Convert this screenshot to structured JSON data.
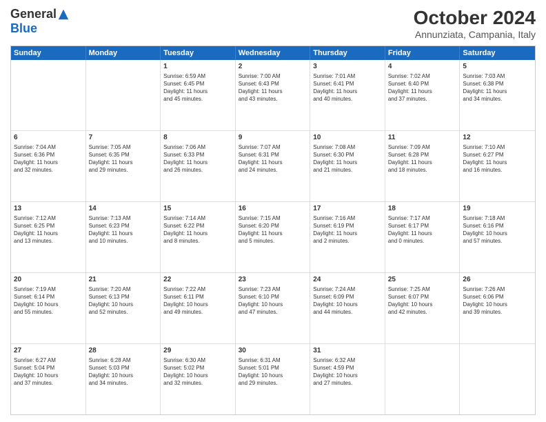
{
  "header": {
    "logo": {
      "general": "General",
      "blue": "Blue"
    },
    "title": "October 2024",
    "subtitle": "Annunziata, Campania, Italy"
  },
  "calendar": {
    "days": [
      "Sunday",
      "Monday",
      "Tuesday",
      "Wednesday",
      "Thursday",
      "Friday",
      "Saturday"
    ],
    "rows": [
      [
        {
          "num": "",
          "text": "",
          "empty": true
        },
        {
          "num": "",
          "text": "",
          "empty": true
        },
        {
          "num": "1",
          "text": "Sunrise: 6:59 AM\nSunset: 6:45 PM\nDaylight: 11 hours\nand 45 minutes."
        },
        {
          "num": "2",
          "text": "Sunrise: 7:00 AM\nSunset: 6:43 PM\nDaylight: 11 hours\nand 43 minutes."
        },
        {
          "num": "3",
          "text": "Sunrise: 7:01 AM\nSunset: 6:41 PM\nDaylight: 11 hours\nand 40 minutes."
        },
        {
          "num": "4",
          "text": "Sunrise: 7:02 AM\nSunset: 6:40 PM\nDaylight: 11 hours\nand 37 minutes."
        },
        {
          "num": "5",
          "text": "Sunrise: 7:03 AM\nSunset: 6:38 PM\nDaylight: 11 hours\nand 34 minutes."
        }
      ],
      [
        {
          "num": "6",
          "text": "Sunrise: 7:04 AM\nSunset: 6:36 PM\nDaylight: 11 hours\nand 32 minutes."
        },
        {
          "num": "7",
          "text": "Sunrise: 7:05 AM\nSunset: 6:35 PM\nDaylight: 11 hours\nand 29 minutes."
        },
        {
          "num": "8",
          "text": "Sunrise: 7:06 AM\nSunset: 6:33 PM\nDaylight: 11 hours\nand 26 minutes."
        },
        {
          "num": "9",
          "text": "Sunrise: 7:07 AM\nSunset: 6:31 PM\nDaylight: 11 hours\nand 24 minutes."
        },
        {
          "num": "10",
          "text": "Sunrise: 7:08 AM\nSunset: 6:30 PM\nDaylight: 11 hours\nand 21 minutes."
        },
        {
          "num": "11",
          "text": "Sunrise: 7:09 AM\nSunset: 6:28 PM\nDaylight: 11 hours\nand 18 minutes."
        },
        {
          "num": "12",
          "text": "Sunrise: 7:10 AM\nSunset: 6:27 PM\nDaylight: 11 hours\nand 16 minutes."
        }
      ],
      [
        {
          "num": "13",
          "text": "Sunrise: 7:12 AM\nSunset: 6:25 PM\nDaylight: 11 hours\nand 13 minutes."
        },
        {
          "num": "14",
          "text": "Sunrise: 7:13 AM\nSunset: 6:23 PM\nDaylight: 11 hours\nand 10 minutes."
        },
        {
          "num": "15",
          "text": "Sunrise: 7:14 AM\nSunset: 6:22 PM\nDaylight: 11 hours\nand 8 minutes."
        },
        {
          "num": "16",
          "text": "Sunrise: 7:15 AM\nSunset: 6:20 PM\nDaylight: 11 hours\nand 5 minutes."
        },
        {
          "num": "17",
          "text": "Sunrise: 7:16 AM\nSunset: 6:19 PM\nDaylight: 11 hours\nand 2 minutes."
        },
        {
          "num": "18",
          "text": "Sunrise: 7:17 AM\nSunset: 6:17 PM\nDaylight: 11 hours\nand 0 minutes."
        },
        {
          "num": "19",
          "text": "Sunrise: 7:18 AM\nSunset: 6:16 PM\nDaylight: 10 hours\nand 57 minutes."
        }
      ],
      [
        {
          "num": "20",
          "text": "Sunrise: 7:19 AM\nSunset: 6:14 PM\nDaylight: 10 hours\nand 55 minutes."
        },
        {
          "num": "21",
          "text": "Sunrise: 7:20 AM\nSunset: 6:13 PM\nDaylight: 10 hours\nand 52 minutes."
        },
        {
          "num": "22",
          "text": "Sunrise: 7:22 AM\nSunset: 6:11 PM\nDaylight: 10 hours\nand 49 minutes."
        },
        {
          "num": "23",
          "text": "Sunrise: 7:23 AM\nSunset: 6:10 PM\nDaylight: 10 hours\nand 47 minutes."
        },
        {
          "num": "24",
          "text": "Sunrise: 7:24 AM\nSunset: 6:09 PM\nDaylight: 10 hours\nand 44 minutes."
        },
        {
          "num": "25",
          "text": "Sunrise: 7:25 AM\nSunset: 6:07 PM\nDaylight: 10 hours\nand 42 minutes."
        },
        {
          "num": "26",
          "text": "Sunrise: 7:26 AM\nSunset: 6:06 PM\nDaylight: 10 hours\nand 39 minutes."
        }
      ],
      [
        {
          "num": "27",
          "text": "Sunrise: 6:27 AM\nSunset: 5:04 PM\nDaylight: 10 hours\nand 37 minutes."
        },
        {
          "num": "28",
          "text": "Sunrise: 6:28 AM\nSunset: 5:03 PM\nDaylight: 10 hours\nand 34 minutes."
        },
        {
          "num": "29",
          "text": "Sunrise: 6:30 AM\nSunset: 5:02 PM\nDaylight: 10 hours\nand 32 minutes."
        },
        {
          "num": "30",
          "text": "Sunrise: 6:31 AM\nSunset: 5:01 PM\nDaylight: 10 hours\nand 29 minutes."
        },
        {
          "num": "31",
          "text": "Sunrise: 6:32 AM\nSunset: 4:59 PM\nDaylight: 10 hours\nand 27 minutes."
        },
        {
          "num": "",
          "text": "",
          "empty": true
        },
        {
          "num": "",
          "text": "",
          "empty": true
        }
      ]
    ]
  }
}
